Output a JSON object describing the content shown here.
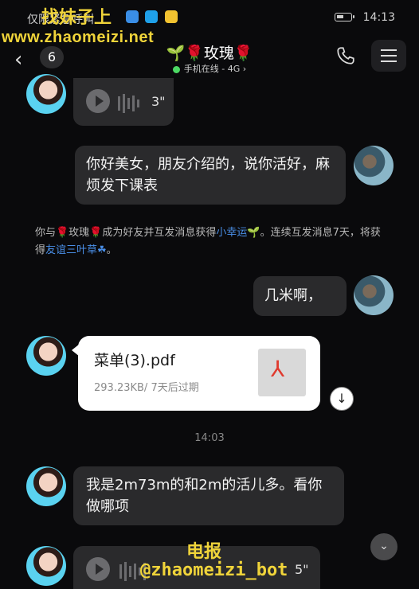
{
  "status": {
    "carrier": "仅限紧急呼叫",
    "time": "14:13",
    "battery_level": 0.45
  },
  "header": {
    "unread_count": "6",
    "title": "🌱🌹玫瑰🌹",
    "subtitle": "手机在线 - 4G",
    "subtitle_arrow": "›"
  },
  "watermarks": {
    "top_line1": "找妹子上",
    "top_line2": "www.zhaomeizi.net",
    "bottom_line1": "电报",
    "bottom_line2": "@zhaomeizi_bot"
  },
  "messages": {
    "voice_top_duration": "3\"",
    "sent_1": "你好美女，朋友介绍的，说你活好，麻烦发下课表",
    "system_notice_prefix": "你与🌹玫瑰🌹成为好友并互发消息获得",
    "system_notice_link1": "小幸运🌱",
    "system_notice_middle": "。连续互发消息7天，将获得",
    "system_notice_link2": "友谊三叶草☘",
    "system_notice_suffix": "。",
    "sent_2": "几米啊，",
    "file_name": "菜单(3).pdf",
    "file_meta": "293.23KB/ 7天后过期",
    "timestamp": "14:03",
    "received_text": "我是2m73m的和2m的活儿多。看你做哪项",
    "voice_bottom_duration": "5\""
  },
  "colors": {
    "accent_link": "#4a8fe8",
    "online": "#4cd964",
    "watermark": "#f0d43a"
  },
  "icons": [
    "back-chevron-icon",
    "phone-icon",
    "menu-icon",
    "play-icon",
    "pdf-icon",
    "download-icon",
    "scroll-down-icon"
  ]
}
